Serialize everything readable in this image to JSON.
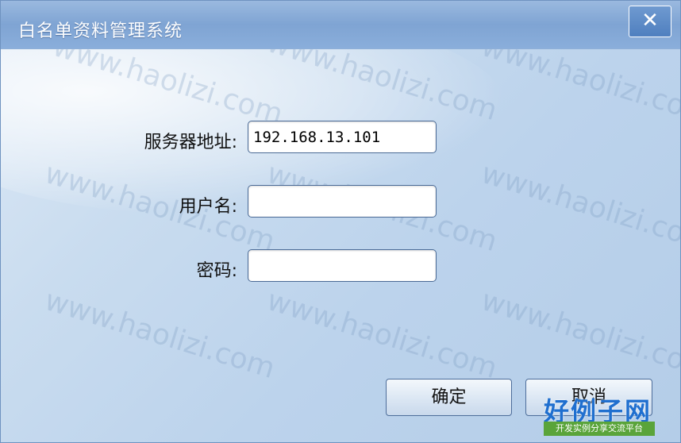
{
  "window": {
    "title": "白名单资料管理系统",
    "close_label": "✕"
  },
  "form": {
    "server_label": "服务器地址:",
    "server_value": "192.168.13.101",
    "username_label": "用户名:",
    "username_value": "",
    "password_label": "密码:",
    "password_value": ""
  },
  "buttons": {
    "ok_label": "确定",
    "cancel_label": "取消"
  },
  "watermark": {
    "text": "www.haolizi.com"
  },
  "logo": {
    "main": "好例子网",
    "sub": "开发实例分享交流平台"
  },
  "colors": {
    "titlebar": "#7fa4d3",
    "background": "#c9dcef",
    "logo_blue": "#1f6fcf",
    "logo_green": "#5aa43a"
  }
}
